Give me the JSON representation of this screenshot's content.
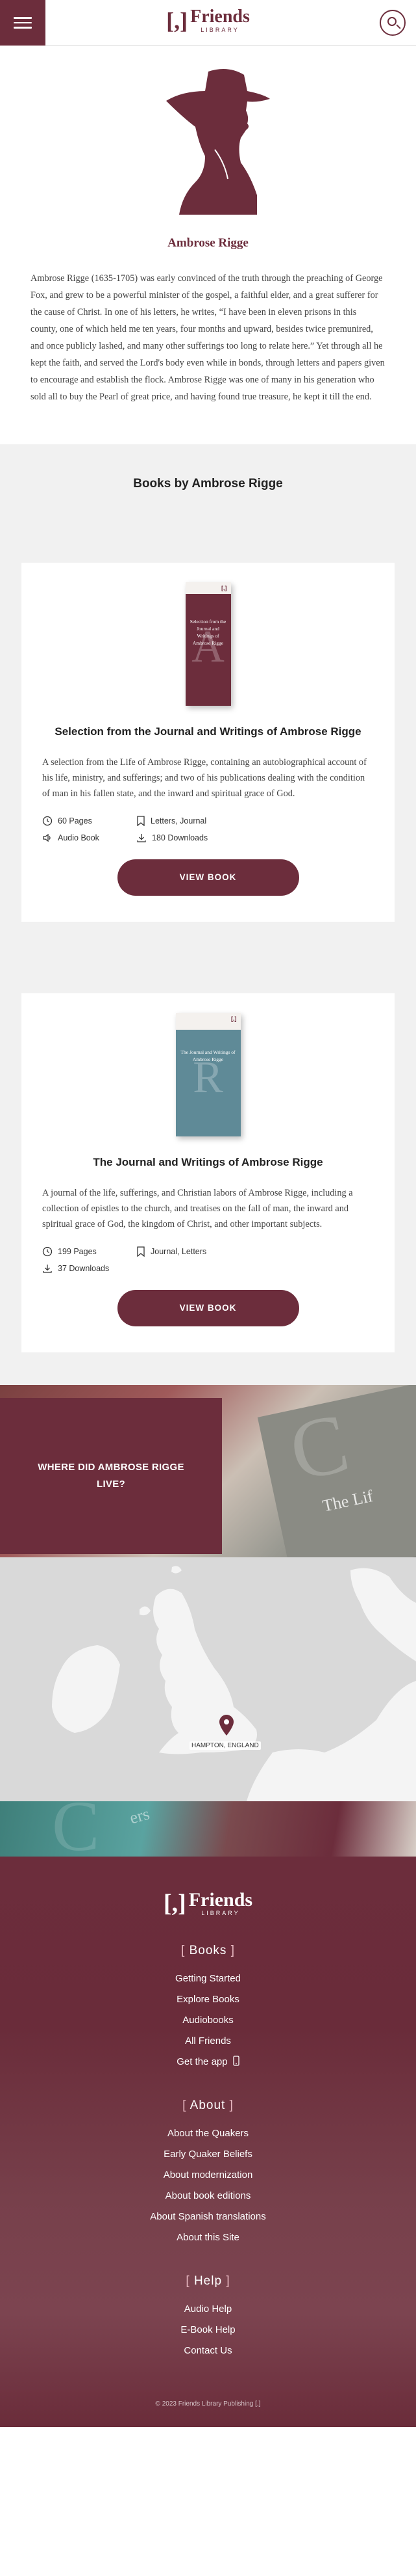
{
  "header": {
    "logo_bracket": "[,]",
    "logo_name": "Friends",
    "logo_sub": "LIBRARY"
  },
  "author": {
    "name": "Ambrose Rigge",
    "bio": "Ambrose Rigge (1635-1705) was early convinced of the truth through the preaching of George Fox, and grew to be a powerful minister of the gospel, a faithful elder, and a great sufferer for the cause of Christ. In one of his letters, he writes, “I have been in eleven prisons in this county, one of which held me ten years, four months and upward, besides twice premunired, and once publicly lashed, and many other sufferings too long to relate here.” Yet through all he kept the faith, and served the Lord's body even while in bonds, through letters and papers given to encourage and establish the flock. Ambrose Rigge was one of many in his generation who sold all to buy the Pearl of great price, and having found true treasure, he kept it till the end."
  },
  "books_section": {
    "title": "Books by Ambrose Rigge",
    "books": [
      {
        "title": "Selection from the Journal and Writings of Ambrose Rigge",
        "cover_title": "Selection from the Journal and Writings of Ambrose Rigge",
        "cover_letter": "A",
        "cover_color": "#6c2d3c",
        "description": "A selection from the Life of Ambrose Rigge, containing an autobiographical account of his life, ministry, and sufferings; and two of his publications dealing with the condition of man in his fallen state, and the inward and spiritual grace of God.",
        "pages": "60 Pages",
        "tags": "Letters, Journal",
        "audio": "Audio Book",
        "downloads": "180 Downloads",
        "button": "VIEW BOOK"
      },
      {
        "title": "The Journal and Writings of Ambrose Rigge",
        "cover_title": "The Journal and Writings of Ambrose Rigge",
        "cover_letter": "R",
        "cover_color": "#5f8a97",
        "description": "A journal of the life, sufferings, and Christian labors of Ambrose Rigge, including a collection of epistles to the church, and treatises on the fall of man, the inward and spiritual grace of God, the kingdom of Christ, and other important subjects.",
        "pages": "199 Pages",
        "tags": "Journal, Letters",
        "downloads": "37 Downloads",
        "button": "VIEW BOOK"
      }
    ]
  },
  "where": {
    "title": "WHERE DID AMBROSE RIGGE LIVE?",
    "bg_letter": "C",
    "bg_text": "The Lif"
  },
  "map": {
    "location": "HAMPTON, ENGLAND"
  },
  "strip": {
    "letter": "C",
    "text": "ers"
  },
  "footer": {
    "books": {
      "heading": "Books",
      "links": [
        "Getting Started",
        "Explore Books",
        "Audiobooks",
        "All Friends",
        "Get the app"
      ]
    },
    "about": {
      "heading": "About",
      "links": [
        "About the Quakers",
        "Early Quaker Beliefs",
        "About modernization",
        "About book editions",
        "About Spanish translations",
        "About this Site"
      ]
    },
    "help": {
      "heading": "Help",
      "links": [
        "Audio Help",
        "E-Book Help",
        "Contact Us"
      ]
    },
    "copyright": "© 2023 Friends Library Publishing"
  },
  "colors": {
    "brand": "#6c2d3c",
    "accent_bracket": "#e7b7c0",
    "books_bg": "#f1f1f1",
    "map_land": "#f4f4f4",
    "map_sea": "#d9d9d9"
  },
  "icons": [
    "menu-icon",
    "search-icon",
    "pages-icon",
    "tag-icon",
    "audio-icon",
    "download-icon",
    "map-pin-icon",
    "phone-icon"
  ]
}
